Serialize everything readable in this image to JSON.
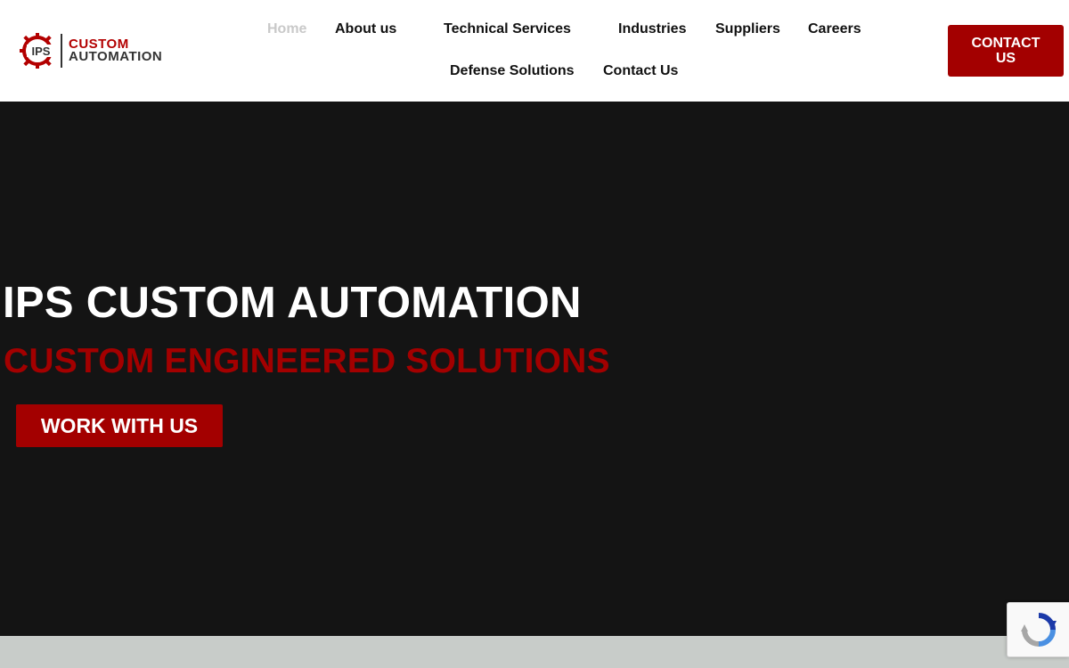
{
  "logo": {
    "line1": "CUSTOM",
    "line2": "AUTOMATION",
    "mark_text": "IPS",
    "mark_icon": "gear-icon"
  },
  "nav": {
    "items": [
      {
        "label": "Home",
        "active": true
      },
      {
        "label": "About us"
      },
      {
        "label": "Technical Services"
      },
      {
        "label": "Industries"
      },
      {
        "label": "Suppliers"
      },
      {
        "label": "Careers"
      },
      {
        "label": "Defense Solutions"
      },
      {
        "label": "Contact Us"
      }
    ]
  },
  "header_cta": {
    "label": "CONTACT US"
  },
  "hero": {
    "title": "IPS CUSTOM AUTOMATION",
    "subtitle": "CUSTOM ENGINEERED SOLUTIONS",
    "button_label": "WORK WITH US"
  },
  "recaptcha": {
    "icon": "recaptcha-icon"
  },
  "colors": {
    "brand_red": "#a30000",
    "hero_bg": "#141414",
    "nav_active": "#c9c9c9",
    "band": "#c8ccc9"
  }
}
